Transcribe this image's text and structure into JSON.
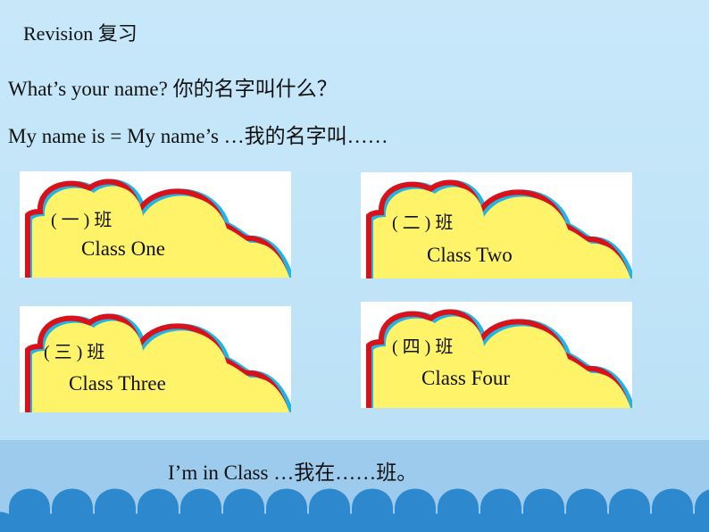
{
  "title": "Revision  复习",
  "line1": "What’s your name?   你的名字叫什么？",
  "line2": "My name is = My name’s …我的名字叫……",
  "cards": [
    {
      "cn": "( 一 ) 班",
      "en": "Class One"
    },
    {
      "cn": "( 二 ) 班",
      "en": "Class Two"
    },
    {
      "cn": "( 三 ) 班",
      "en": "Class Three"
    },
    {
      "cn": "( 四 ) 班",
      "en": "Class Four"
    }
  ],
  "footer": "I’m in Class …我在……班。",
  "colors": {
    "cloud_fill": "#fff36a",
    "cloud_inner_border": "#d8111a",
    "cloud_outer_border": "#1fb5e6",
    "arches": "#2e88cd",
    "band": "#9ccbee"
  }
}
